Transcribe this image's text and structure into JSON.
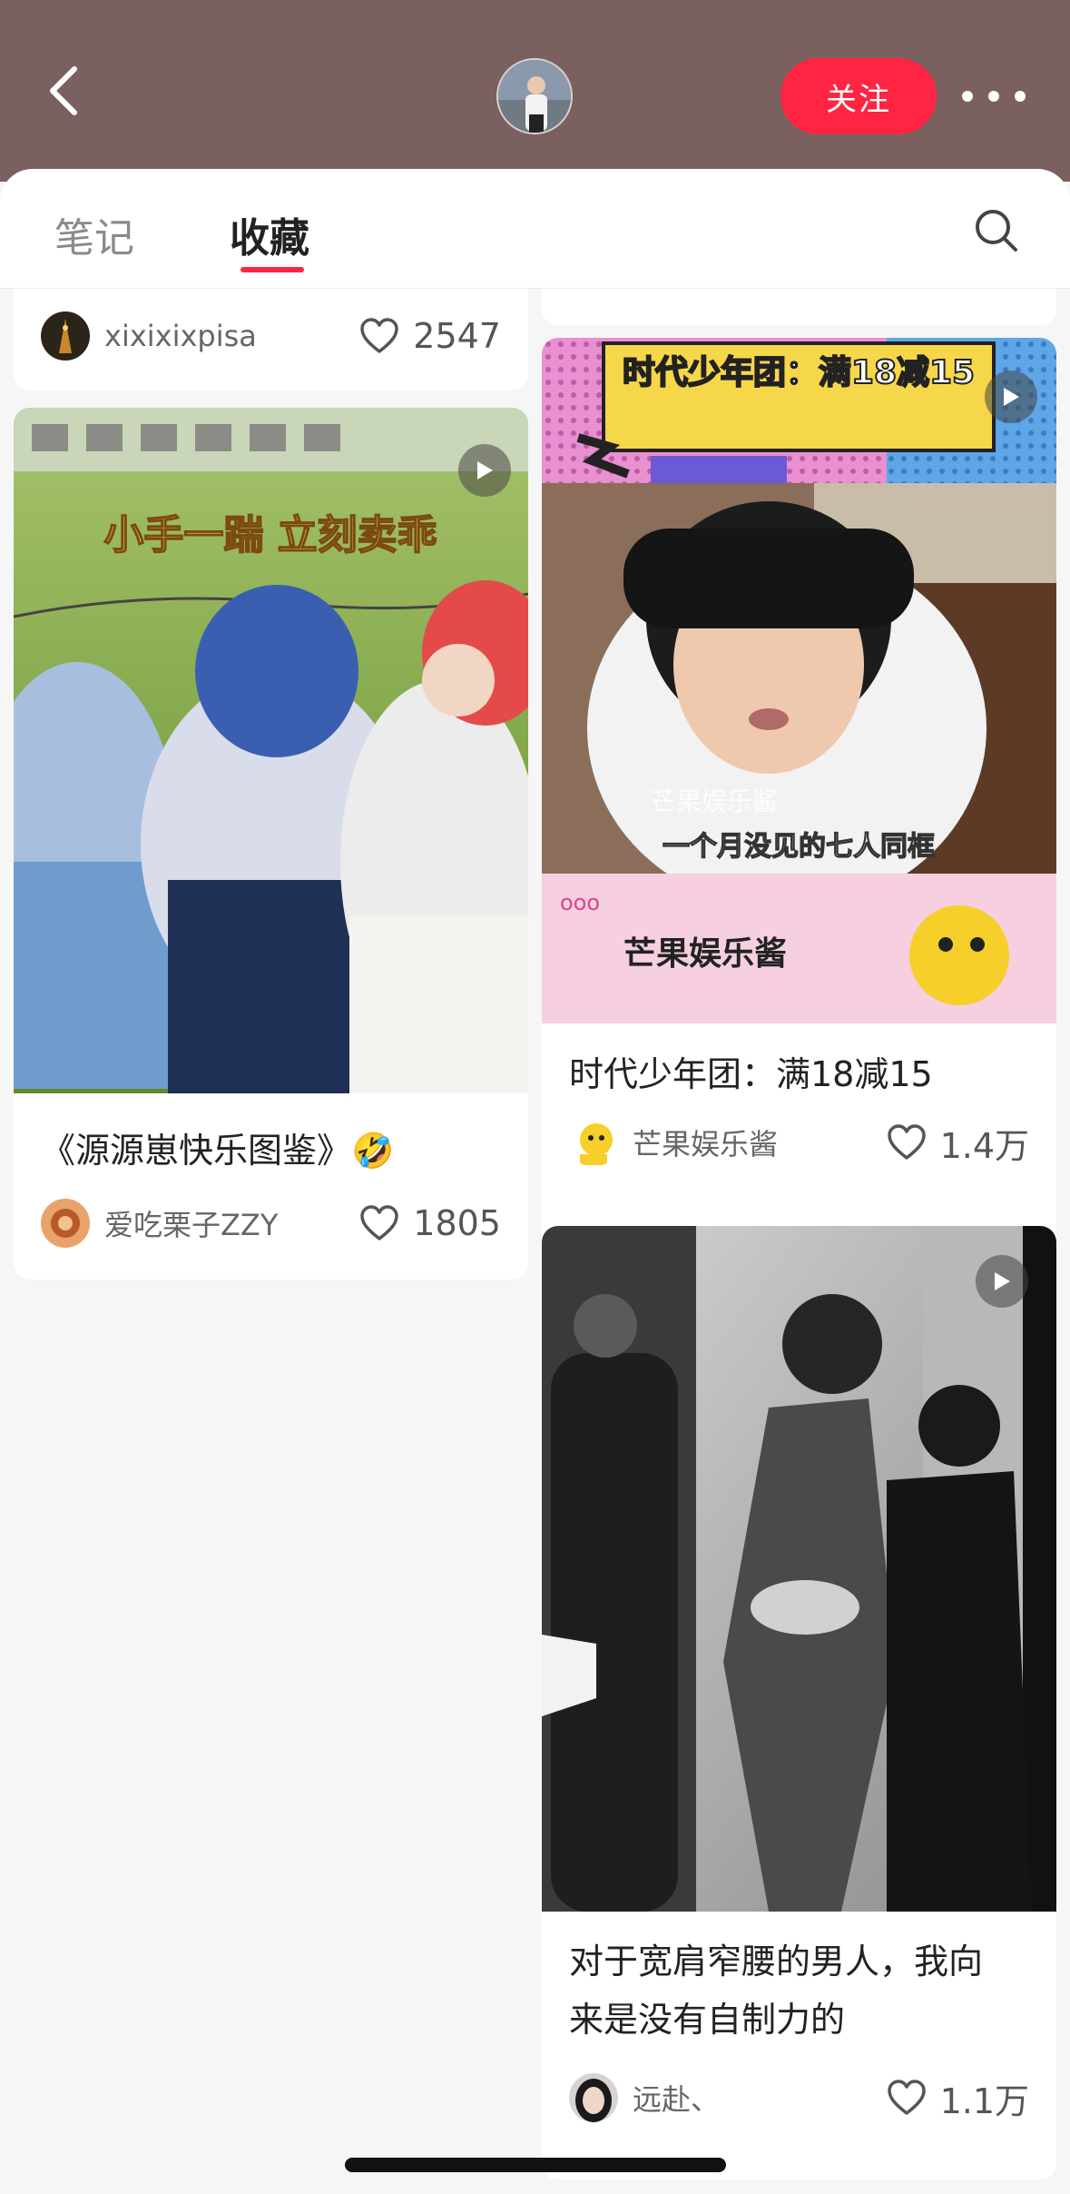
{
  "header": {
    "follow_label": "关注",
    "bg_color": "#7a605f",
    "accent": "#ff2442"
  },
  "tabs": [
    {
      "label": "笔记",
      "active": false
    },
    {
      "label": "收藏",
      "active": true
    }
  ],
  "feed": {
    "left": [
      {
        "title": "",
        "author": "xixixixpisa",
        "likes": "2547",
        "partial": true
      },
      {
        "overlay_text": "小手一踹 立刻卖乖",
        "title": "《源源崽快乐图鉴》🤣",
        "author": "爱吃栗子ZZY",
        "likes": "1805",
        "video": true
      }
    ],
    "right": [
      {
        "banner_text": "时代少年团：满18减15",
        "subtitle_text": "芒果娱乐酱",
        "caption_text": "一个月没见的七人同框",
        "bottom_text": "芒果娱乐酱",
        "title": "时代少年团：满18减15",
        "author": "芒果娱乐酱",
        "likes": "1.4万",
        "video": true
      },
      {
        "title_line1": "对于宽肩窄腰的男人，我向",
        "title_line2": "来是没有自制力的",
        "author": "远赴、",
        "likes": "1.1万",
        "video": true
      }
    ]
  },
  "icons": [
    "back-arrow-icon",
    "more-dots-icon",
    "search-icon",
    "heart-icon",
    "play-icon"
  ]
}
